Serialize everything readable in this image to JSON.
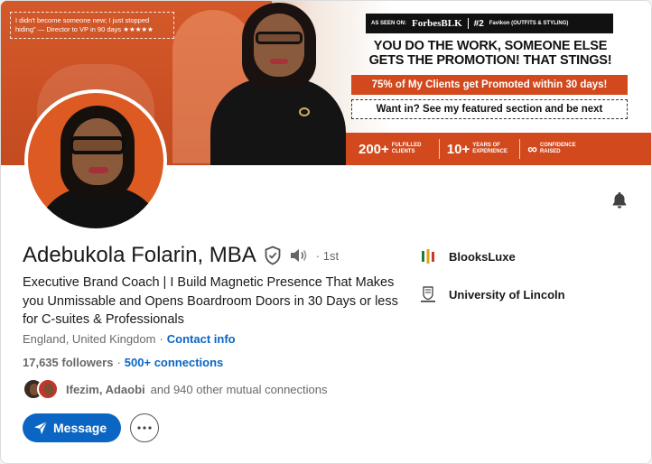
{
  "banner": {
    "quote": "I didn't become someone new; I just stopped hiding\" — Director to VP in 90 days ★★★★★",
    "as_seen_label": "AS SEEN ON:",
    "as_seen_brand": "ForbesBLK",
    "as_seen_rank": "#2",
    "as_seen_favikon": "Favikon (OUTFITS & STYLING)",
    "headline_line1": "YOU DO THE WORK, SOMEONE ELSE",
    "headline_line2": "GETS THE PROMOTION! THAT STINGS!",
    "promo": "75% of My Clients get Promoted within 30 days!",
    "cta": "Want in? See my featured section and be next",
    "stats": [
      {
        "num": "200+",
        "label": "FULFILLED CLIENTS"
      },
      {
        "num": "10+",
        "label": "YEARS OF EXPERIENCE"
      },
      {
        "num": "∞",
        "label": "CONFIDENCE RAISED"
      }
    ]
  },
  "profile": {
    "name": "Adebukola Folarin, MBA",
    "degree": "· 1st",
    "headline": "Executive Brand Coach | I Build Magnetic Presence That Makes you Unmissable and Opens Boardroom Doors in 30 Days or less for C-suites & Professionals",
    "location": "England, United Kingdom",
    "location_sep": "·",
    "contact_label": "Contact info",
    "followers": "17,635 followers",
    "followers_sep": "·",
    "connections": "500+ connections",
    "mutual_names": "Ifezim, Adaobi",
    "mutual_rest": "and 940 other mutual connections"
  },
  "organizations": [
    {
      "name": "BlooksLuxe",
      "icon": "blooksluxe-logo"
    },
    {
      "name": "University of Lincoln",
      "icon": "university-of-lincoln-logo"
    }
  ],
  "actions": {
    "message_label": "Message",
    "more_icon": "more-horizontal-icon"
  },
  "colors": {
    "primary": "#0a66c2",
    "banner_orange": "#d2491d",
    "avatar_bg": "#dd5a22"
  }
}
